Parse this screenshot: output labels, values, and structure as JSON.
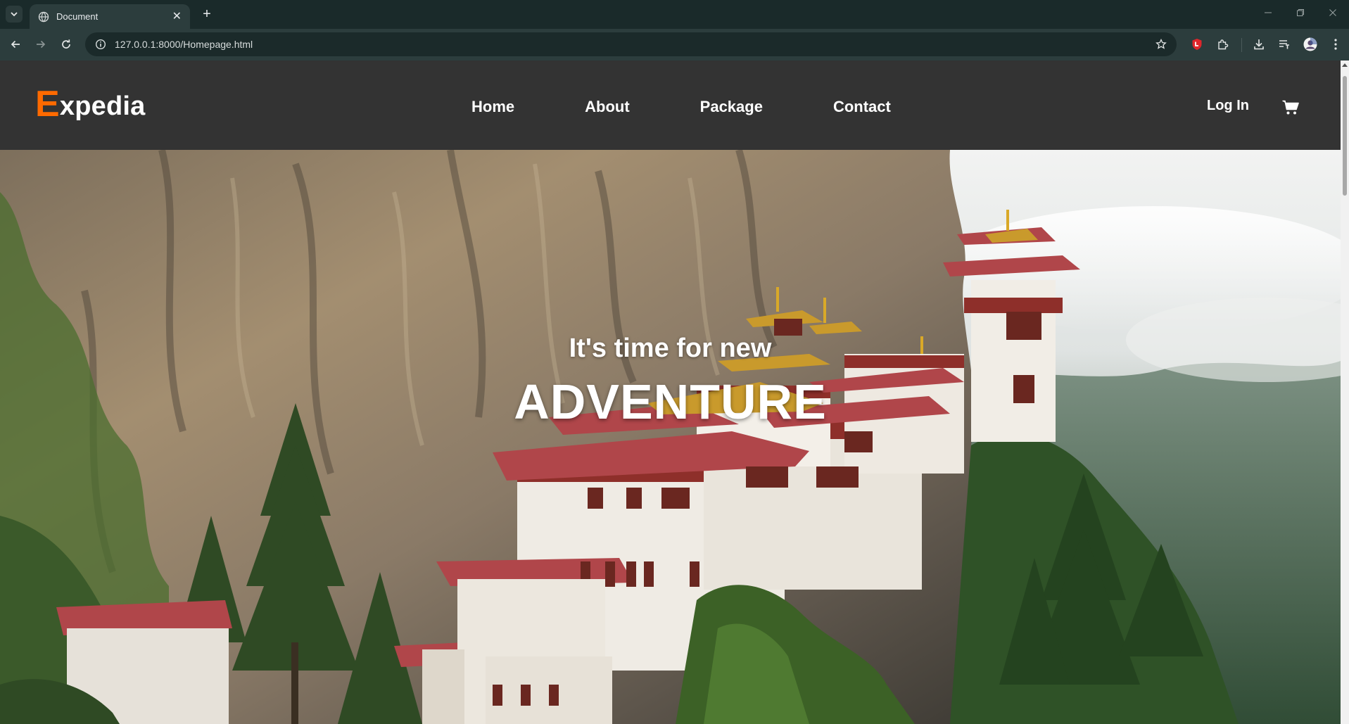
{
  "browser": {
    "tab_title": "Document",
    "url": "127.0.0.1:8000/Homepage.html",
    "icons": [
      "tab-search-icon",
      "globe-icon",
      "close-icon",
      "new-tab-icon",
      "back-icon",
      "forward-icon",
      "reload-icon",
      "site-info-icon",
      "bookmark-star-icon",
      "extension-shield-icon",
      "extensions-puzzle-icon",
      "downloads-icon",
      "reading-list-icon",
      "profile-avatar",
      "kebab-menu-icon",
      "minimize-icon",
      "restore-icon",
      "window-close-icon"
    ]
  },
  "site": {
    "logo_first": "E",
    "logo_rest": "xpedia",
    "nav": [
      {
        "label": "Home"
      },
      {
        "label": "About"
      },
      {
        "label": "Package"
      },
      {
        "label": "Contact"
      }
    ],
    "login_label": "Log In",
    "cart_icon": "shopping-cart-icon",
    "colors": {
      "header_bg": "#333333",
      "accent": "#ff6a00",
      "text": "#ffffff"
    }
  },
  "hero": {
    "subtitle": "It's time for new",
    "title": "ADVENTURE",
    "image": "cliffside-monastery-photo"
  }
}
